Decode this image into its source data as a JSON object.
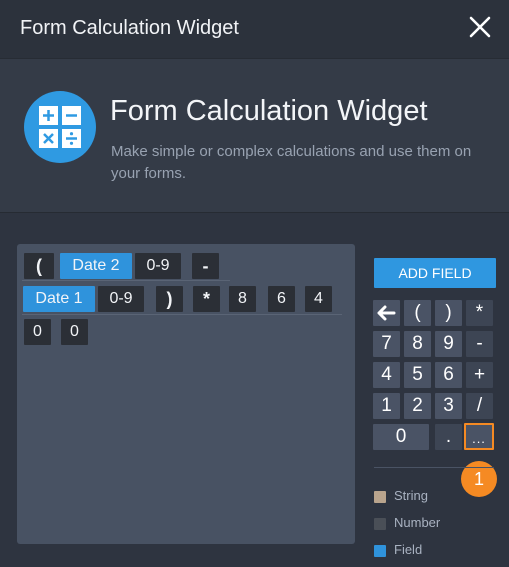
{
  "window": {
    "title": "Form Calculation Widget"
  },
  "header": {
    "title": "Form Calculation Widget",
    "subtitle": "Make simple or complex calculations and use them on your forms."
  },
  "formula": {
    "tokens": [
      {
        "label": "(",
        "kind": "op"
      },
      {
        "label": "Date 2",
        "kind": "field"
      },
      {
        "label": "0-9",
        "kind": "number"
      },
      {
        "label": "-",
        "kind": "op"
      },
      {
        "label": "Date 1",
        "kind": "field"
      },
      {
        "label": "0-9",
        "kind": "number"
      },
      {
        "label": ")",
        "kind": "op"
      },
      {
        "label": "*",
        "kind": "op"
      },
      {
        "label": "8",
        "kind": "number"
      },
      {
        "label": "6",
        "kind": "number"
      },
      {
        "label": "4",
        "kind": "number"
      },
      {
        "label": "0",
        "kind": "number"
      },
      {
        "label": "0",
        "kind": "number"
      }
    ]
  },
  "keypad": {
    "add_field_label": "ADD FIELD",
    "keys": [
      "←",
      "(",
      ")",
      "*",
      "7",
      "8",
      "9",
      "-",
      "4",
      "5",
      "6",
      "+",
      "1",
      "2",
      "3",
      "/",
      "0",
      ".",
      "..."
    ]
  },
  "callout": {
    "number": "1",
    "color": "#f58a23"
  },
  "legend": [
    {
      "label": "String",
      "color": "#b9a48d"
    },
    {
      "label": "Number",
      "color": "#4a4f57"
    },
    {
      "label": "Field",
      "color": "#2f93dc"
    }
  ],
  "colors": {
    "accent": "#2f97e0",
    "highlight": "#f58a23"
  }
}
